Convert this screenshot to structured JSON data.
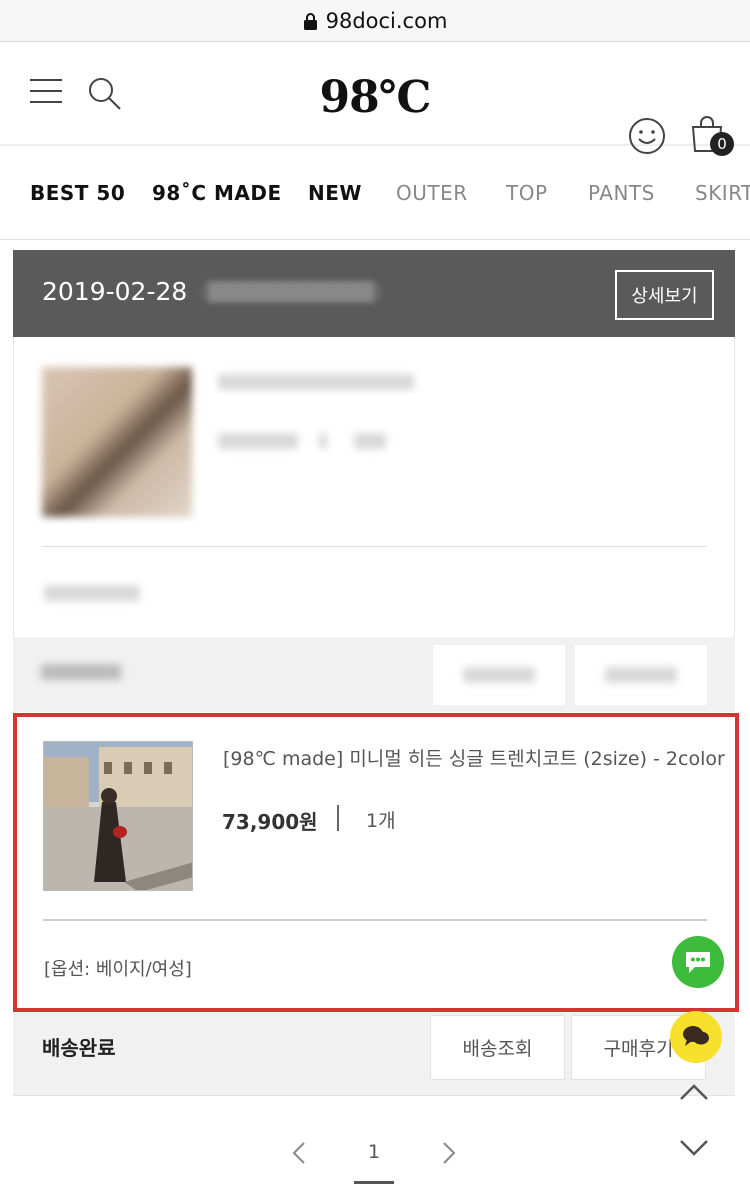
{
  "browser": {
    "url": "98doci.com"
  },
  "header": {
    "logo": "98℃",
    "cart_count": "0"
  },
  "categories": [
    "BEST 50",
    "98˚C MADE",
    "NEW",
    "OUTER",
    "TOP",
    "PANTS",
    "SKIRT"
  ],
  "order": {
    "date": "2019-02-28",
    "detail_button": "상세보기"
  },
  "item": {
    "name": "[98℃ made] 미니멀 히든 싱글 트렌치코트 (2size) - 2color",
    "price": "73,900원",
    "quantity": "1개",
    "option": "[옵션: 베이지/여성]",
    "status": "배송완료",
    "track_button": "배송조회",
    "review_button": "구매후기"
  },
  "pagination": {
    "current": "1"
  },
  "colors": {
    "highlight": "#d63333",
    "order_header": "#5a5a5a",
    "chat_green": "#3dbb3a",
    "chat_yellow": "#f8e12c"
  }
}
